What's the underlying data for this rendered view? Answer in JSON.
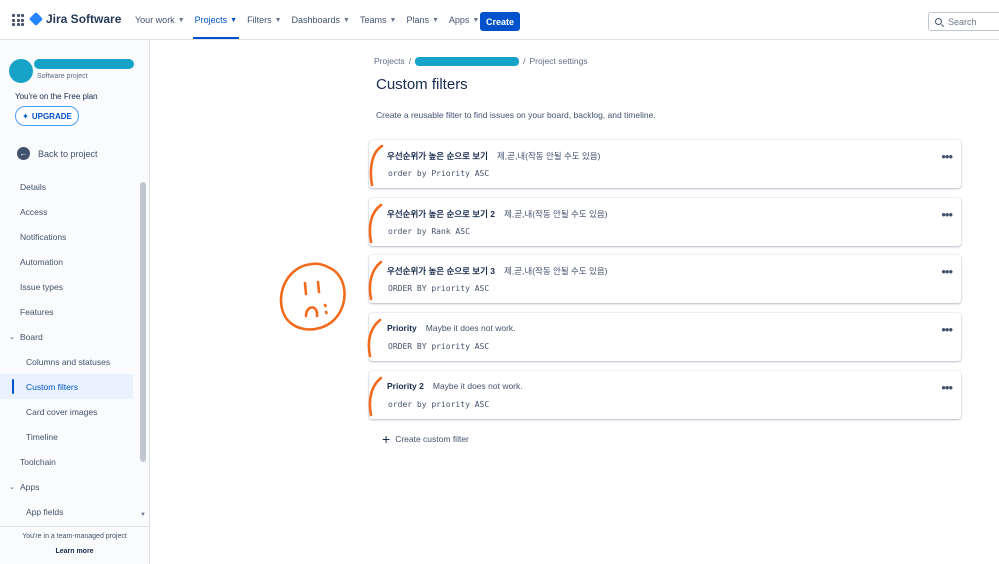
{
  "topnav": {
    "product_name": "Jira Software",
    "items": [
      {
        "label": "Your work",
        "active": false
      },
      {
        "label": "Projects",
        "active": true
      },
      {
        "label": "Filters",
        "active": false
      },
      {
        "label": "Dashboards",
        "active": false
      },
      {
        "label": "Teams",
        "active": false
      },
      {
        "label": "Plans",
        "active": false
      },
      {
        "label": "Apps",
        "active": false
      }
    ],
    "create_label": "Create",
    "search_placeholder": "Search",
    "brand_color": "#0052cc"
  },
  "sidebar": {
    "project_type": "Software project",
    "plan_text": "You're on the Free plan",
    "upgrade_label": "UPGRADE",
    "back_label": "Back to project",
    "items": {
      "details": "Details",
      "access": "Access",
      "notifications": "Notifications",
      "automation": "Automation",
      "issue_types": "Issue types",
      "features": "Features",
      "board": "Board",
      "columns_and_statuses": "Columns and statuses",
      "custom_filters": "Custom filters",
      "card_cover_images": "Card cover images",
      "timeline": "Timeline",
      "toolchain": "Toolchain",
      "apps": "Apps",
      "app_fields": "App fields"
    },
    "selected_item": "Custom filters",
    "footer_text": "You're in a team-managed project",
    "footer_link": "Learn more"
  },
  "main": {
    "breadcrumb": {
      "root": "Projects",
      "separator": "/",
      "current": "Project settings"
    },
    "title": "Custom filters",
    "description": "Create a reusable filter to find issues on your board, backlog, and timeline.",
    "filters": [
      {
        "name": "우선순위가 높은 순으로 보기",
        "description": "제,곧,내(작동 안될 수도 있음)",
        "jql": "order by Priority ASC"
      },
      {
        "name": "우선순위가 높은 순으로 보기 2",
        "description": "제,곧,내(작동 안될 수도 있음)",
        "jql": "order by Rank ASC"
      },
      {
        "name": "우선순위가 높은 순으로 보기 3",
        "description": "제,곧,내(작동 안될 수도 있음)",
        "jql": "ORDER BY priority ASC"
      },
      {
        "name": "Priority",
        "description": "Maybe it does not work.",
        "jql": "ORDER BY priority ASC"
      },
      {
        "name": "Priority 2",
        "description": "Maybe it does not work.",
        "jql": "order by priority ASC"
      }
    ],
    "more_icon": "more-horizontal-icon",
    "create_filter_label": "Create custom filter"
  },
  "annotation_color": "#f26b1d"
}
